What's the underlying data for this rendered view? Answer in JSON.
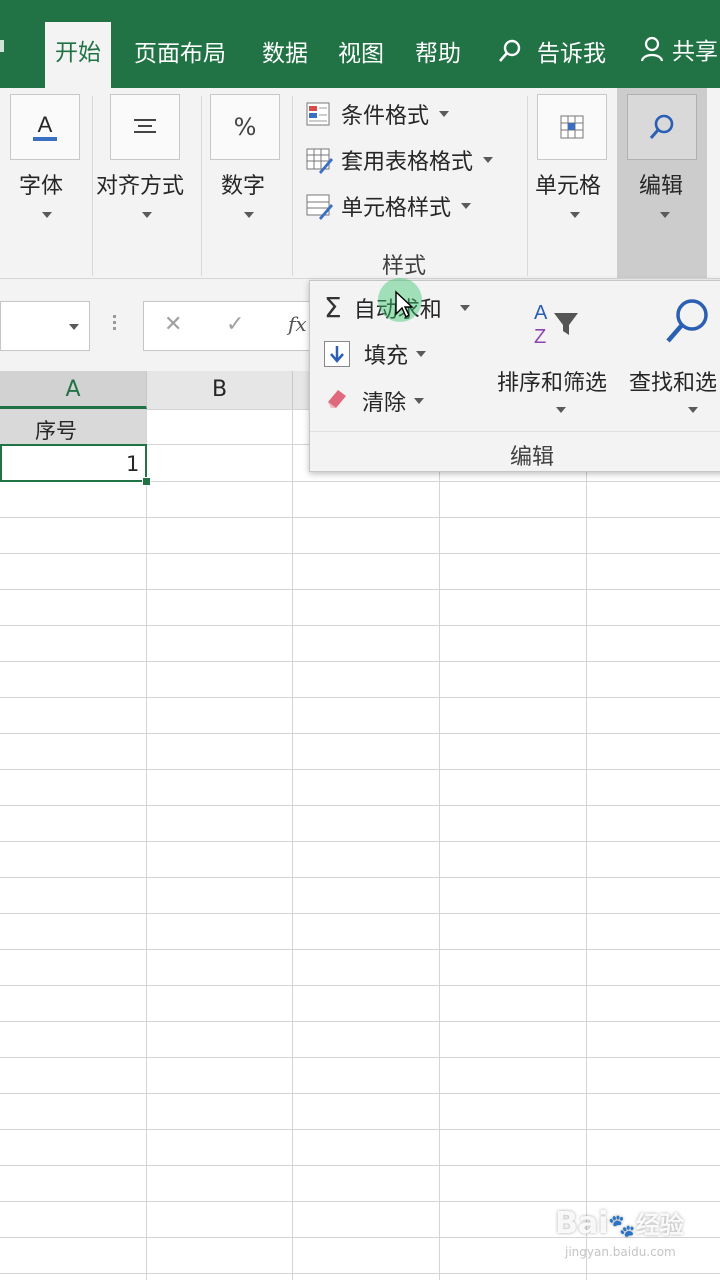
{
  "tabs": {
    "home": "开始",
    "page_layout": "页面布局",
    "data": "数据",
    "view": "视图",
    "help": "帮助",
    "tell_me": "告诉我",
    "share": "共享"
  },
  "ribbon": {
    "font": "字体",
    "alignment": "对齐方式",
    "number": "数字",
    "styles": {
      "conditional_formatting": "条件格式",
      "format_as_table": "套用表格格式",
      "cell_styles": "单元格样式",
      "group_label": "样式"
    },
    "cells": "单元格",
    "editing": "编辑"
  },
  "formula_bar": {
    "fx": "fx"
  },
  "editing_dropdown": {
    "autosum": "自动求和",
    "fill": "填充",
    "clear": "清除",
    "sort_filter": "排序和筛选",
    "find_select": "查找和选",
    "group_label": "编辑"
  },
  "sheet": {
    "columns": [
      "A",
      "B"
    ],
    "a1": "序号",
    "a2": "1"
  },
  "watermark": {
    "brand": "Bai",
    "brand2": "经验",
    "url": "jingyan.baidu.com"
  },
  "colors": {
    "accent": "#217346",
    "ribbon_bg": "#f3f3f3"
  }
}
